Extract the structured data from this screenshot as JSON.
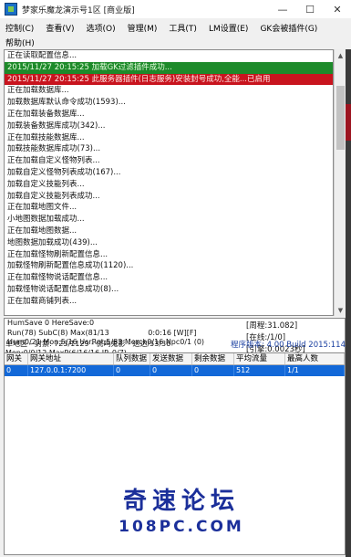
{
  "window": {
    "title": "梦家乐魔龙演示号1区 [商业版]",
    "buttons": [
      "—",
      "☐",
      "✕"
    ]
  },
  "menu": {
    "row1": [
      "控制(C)",
      "查看(V)",
      "选项(O)",
      "管理(M)",
      "工具(T)",
      "LM设置(E)",
      "GK会被插件(G)"
    ],
    "row2": [
      "帮助(H)"
    ]
  },
  "log": [
    {
      "text": "正在读取配置信息...",
      "style": "normal"
    },
    {
      "text": "2015/11/27 20:15:25 加载GK过滤插件成功...",
      "style": "green"
    },
    {
      "text": "2015/11/27 20:15:25 此服务器插件(日志服务)安装封号成功,全能...已启用",
      "style": "red"
    },
    {
      "text": "正在加载数据库...",
      "style": "normal"
    },
    {
      "text": "加载数据库默认命令成功(1593)...",
      "style": "normal"
    },
    {
      "text": "正在加载装备数据库...",
      "style": "normal"
    },
    {
      "text": "加载装备数据库成功(342)...",
      "style": "normal"
    },
    {
      "text": "正在加载技能数据库...",
      "style": "normal"
    },
    {
      "text": "加载技能数据库成功(73)...",
      "style": "normal"
    },
    {
      "text": "正在加载自定义怪物列表...",
      "style": "normal"
    },
    {
      "text": "加载自定义怪物列表成功(167)...",
      "style": "normal"
    },
    {
      "text": "加载自定义技能列表...",
      "style": "normal"
    },
    {
      "text": "加载自定义技能列表成功...",
      "style": "normal"
    },
    {
      "text": "正在加载地图文件...",
      "style": "normal"
    },
    {
      "text": "小地图数据加载成功...",
      "style": "normal"
    },
    {
      "text": "正在加载地图数据...",
      "style": "normal"
    },
    {
      "text": "地图数据加载成功(439)...",
      "style": "normal"
    },
    {
      "text": "正在加载怪物刷新配置信息...",
      "style": "normal"
    },
    {
      "text": "加载怪物刷新配置信息成功(1120)...",
      "style": "normal"
    },
    {
      "text": "正在加载怪物说话配置信息...",
      "style": "normal"
    },
    {
      "text": "加载怪物说话配置信息成功(8)...",
      "style": "normal"
    },
    {
      "text": "正在加载商铺列表...",
      "style": "normal"
    }
  ],
  "status": {
    "lines": [
      "HumSave 0 HereSave:0",
      "Run(78) SubC(8) Max(81/13",
      "Hum0/21 Mon.5/16 UsrRot.5/83 Merch0/16 Npc0/1 (0)"
    ],
    "mid_line": "0:0:16 [W][F]",
    "connections": "[在线:/1/0]",
    "cycle": "[周程:31.082]",
    "ratio": "[引擎:0.0023秒]"
  },
  "bottom_lines": [
    "单地区 - 封禁: 723/1129 - 优鸣鬼影 - 送达/53/36",
    "Mon:0/0/12 MaxP(6/16/16 IP_0/7)"
  ],
  "version": "程序版本: 4.00 Build 2015:114",
  "grid": {
    "headers": [
      "网关",
      "网关地址",
      "队列数据",
      "发送数据",
      "剩余数据",
      "平均流量",
      "最高人数"
    ],
    "rows": [
      [
        "0",
        "127.0.0.1:7200",
        "0",
        "0",
        "0",
        "512",
        "1/1"
      ]
    ]
  },
  "watermark": {
    "main": "奇速论坛",
    "sub": "108PC.COM"
  }
}
